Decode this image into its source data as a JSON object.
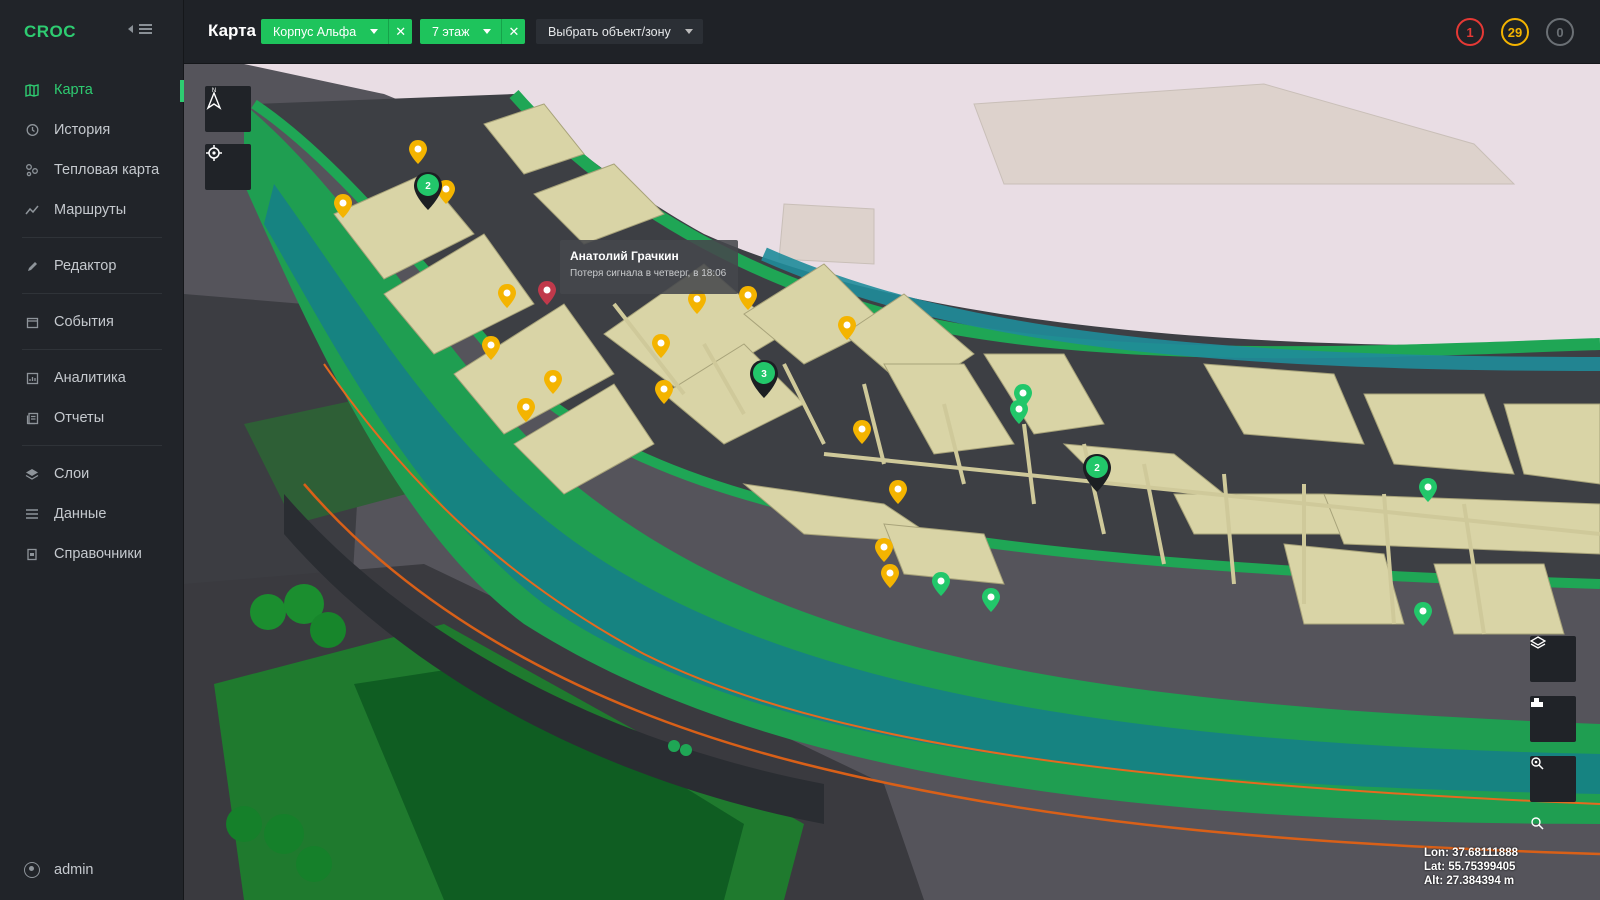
{
  "app": {
    "brand": "CROC"
  },
  "sidebar": {
    "items": [
      {
        "label": "Карта",
        "icon": "map-icon",
        "active": true
      },
      {
        "label": "История",
        "icon": "history-icon"
      },
      {
        "label": "Тепловая карта",
        "icon": "heatmap-icon"
      },
      {
        "label": "Маршруты",
        "icon": "routes-icon"
      },
      {
        "label": "Редактор",
        "icon": "pencil-icon"
      },
      {
        "label": "События",
        "icon": "calendar-icon"
      },
      {
        "label": "Аналитика",
        "icon": "analytics-icon"
      },
      {
        "label": "Отчеты",
        "icon": "reports-icon"
      },
      {
        "label": "Слои",
        "icon": "layers-icon"
      },
      {
        "label": "Данные",
        "icon": "list-icon"
      },
      {
        "label": "Справочники",
        "icon": "book-icon"
      }
    ],
    "user": "admin"
  },
  "topbar": {
    "title": "Карта",
    "filters": [
      {
        "label": "Корпус Альфа"
      },
      {
        "label": "7 этаж"
      }
    ],
    "object_select": "Выбрать объект/зону",
    "badges": [
      {
        "value": "1",
        "color": "#e53935"
      },
      {
        "value": "29",
        "color": "#f4b400"
      },
      {
        "value": "0",
        "color": "#6b7075"
      }
    ]
  },
  "map": {
    "tooltip": {
      "name": "Анатолий Грачкин",
      "status": "Потеря сигнала в четверг, в 18:06"
    },
    "cluster_labels": [
      "2",
      "3",
      "2"
    ],
    "coords": {
      "lon": "Lon: 37.68111888",
      "lat": "Lat: 55.75399405",
      "alt": "Alt: 27.384394 m"
    }
  },
  "colors": {
    "accent": "#1ec45c",
    "pin_yellow": "#f4b400",
    "pin_red": "#c0394b",
    "pin_green": "#22c76a"
  }
}
